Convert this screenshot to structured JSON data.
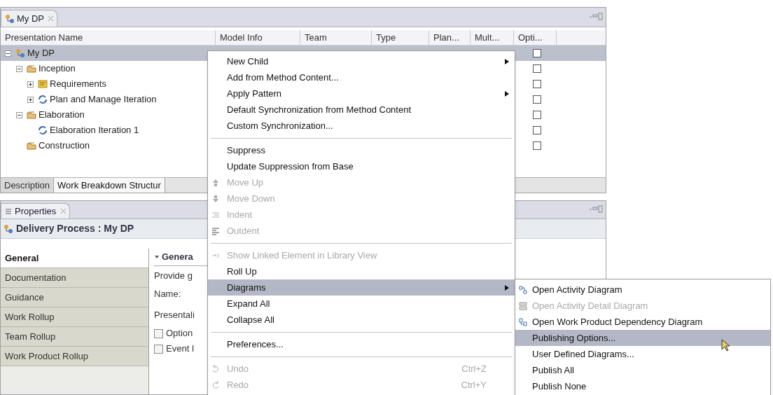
{
  "editor": {
    "tab": "My DP",
    "columns": [
      "Presentation Name",
      "Model Info",
      "Team",
      "Type",
      "Plan...",
      "Mult...",
      "Opti..."
    ],
    "rows": [
      {
        "label": "My DP",
        "kind": "process",
        "expanded": true,
        "selected": true,
        "checked": false,
        "children": [
          {
            "label": "Inception",
            "kind": "phase",
            "expanded": true,
            "selected": false,
            "checked": false,
            "children": [
              {
                "label": "Requirements",
                "kind": "activity",
                "expanded": false,
                "selected": false,
                "checked": false
              },
              {
                "label": "Plan and Manage Iteration",
                "kind": "iteration",
                "expanded": false,
                "selected": false,
                "checked": false
              }
            ]
          },
          {
            "label": "Elaboration",
            "kind": "phase",
            "expanded": true,
            "selected": false,
            "checked": false,
            "children": [
              {
                "label": "Elaboration Iteration 1",
                "kind": "iteration",
                "selected": false,
                "checked": false
              }
            ]
          },
          {
            "label": "Construction",
            "kind": "phase",
            "selected": false,
            "checked": false
          }
        ]
      }
    ],
    "bottom_tabs": [
      {
        "label": "Description",
        "selected": false
      },
      {
        "label": "Work Breakdown Structur",
        "selected": true
      }
    ]
  },
  "properties": {
    "tab": "Properties",
    "heading": "Delivery Process : My DP",
    "side_tabs": [
      {
        "label": "General",
        "selected": true
      },
      {
        "label": "Documentation",
        "selected": false
      },
      {
        "label": "Guidance",
        "selected": false
      },
      {
        "label": "Work Rollup",
        "selected": false
      },
      {
        "label": "Team Rollup",
        "selected": false
      },
      {
        "label": "Work Product Rollup",
        "selected": false
      }
    ],
    "section_title": "Genera",
    "description": "Provide g",
    "fields": [
      "Name:",
      "Presentali"
    ],
    "checkboxes": [
      {
        "label": "Option",
        "checked": false
      },
      {
        "label": "Event I",
        "checked": false
      }
    ]
  },
  "context_menu": [
    {
      "kind": "item",
      "label": "New Child",
      "submenu": true,
      "disabled": false,
      "selected": false
    },
    {
      "kind": "item",
      "label": "Add from Method Content...",
      "disabled": false,
      "selected": false
    },
    {
      "kind": "item",
      "label": "Apply Pattern",
      "submenu": true,
      "disabled": false,
      "selected": false
    },
    {
      "kind": "item",
      "label": "Default Synchronization from Method Content",
      "disabled": false,
      "selected": false
    },
    {
      "kind": "item",
      "label": "Custom Synchronization...",
      "disabled": false,
      "selected": false
    },
    {
      "kind": "separator"
    },
    {
      "kind": "item",
      "label": "Suppress",
      "disabled": false,
      "selected": false
    },
    {
      "kind": "item",
      "label": "Update Suppression from Base",
      "disabled": false,
      "selected": false
    },
    {
      "kind": "item",
      "label": "Move Up",
      "disabled": true,
      "selected": false
    },
    {
      "kind": "item",
      "label": "Move Down",
      "disabled": true,
      "selected": false
    },
    {
      "kind": "item",
      "label": "Indent",
      "disabled": true,
      "selected": false
    },
    {
      "kind": "item",
      "label": "Outdent",
      "disabled": true,
      "selected": false
    },
    {
      "kind": "separator"
    },
    {
      "kind": "item",
      "label": "Show Linked Element in Library View",
      "disabled": true,
      "selected": false
    },
    {
      "kind": "item",
      "label": "Roll Up",
      "disabled": false,
      "selected": false
    },
    {
      "kind": "item",
      "label": "Diagrams",
      "submenu": true,
      "disabled": false,
      "selected": true
    },
    {
      "kind": "item",
      "label": "Expand All",
      "disabled": false,
      "selected": false
    },
    {
      "kind": "item",
      "label": "Collapse All",
      "disabled": false,
      "selected": false
    },
    {
      "kind": "separator"
    },
    {
      "kind": "item",
      "label": "Preferences...",
      "disabled": false,
      "selected": false
    },
    {
      "kind": "separator"
    },
    {
      "kind": "item",
      "label": "Undo",
      "shortcut": "Ctrl+Z",
      "disabled": true,
      "selected": false
    },
    {
      "kind": "item",
      "label": "Redo",
      "shortcut": "Ctrl+Y",
      "disabled": true,
      "selected": false
    }
  ],
  "diagrams_submenu": [
    {
      "label": "Open Activity Diagram",
      "disabled": false,
      "selected": false
    },
    {
      "label": "Open Activity Detail Diagram",
      "disabled": true,
      "selected": false
    },
    {
      "label": "Open Work Product Dependency Diagram",
      "disabled": false,
      "selected": false
    },
    {
      "label": "Publishing Options...",
      "disabled": false,
      "selected": true
    },
    {
      "label": "User Defined Diagrams...",
      "disabled": false,
      "selected": false
    },
    {
      "label": "Publish All",
      "disabled": false,
      "selected": false
    },
    {
      "label": "Publish None",
      "disabled": false,
      "selected": false
    }
  ]
}
